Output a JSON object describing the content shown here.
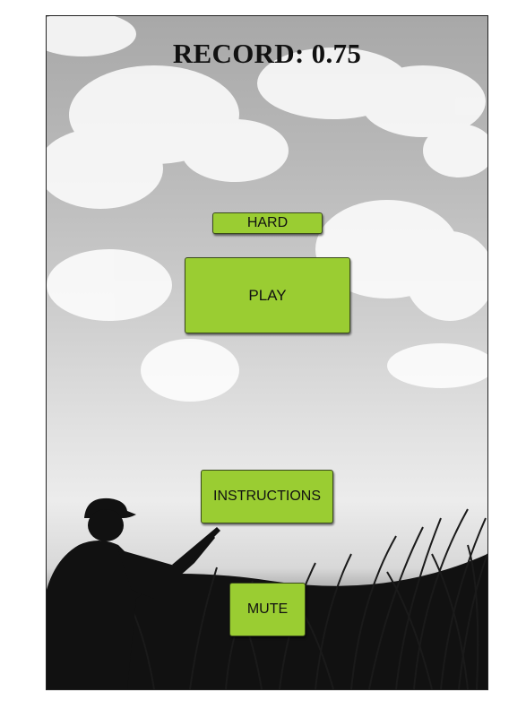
{
  "game": {
    "record_label": "RECORD: 0.75",
    "buttons": {
      "difficulty": "HARD",
      "play": "PLAY",
      "instructions": "INSTRUCTIONS",
      "mute": "MUTE"
    }
  },
  "colors": {
    "button_fill": "#9acd32",
    "button_border": "#3a4a1c",
    "silhouette": "#111111"
  },
  "icons": [
    "hunter-silhouette",
    "cloud",
    "grass"
  ]
}
